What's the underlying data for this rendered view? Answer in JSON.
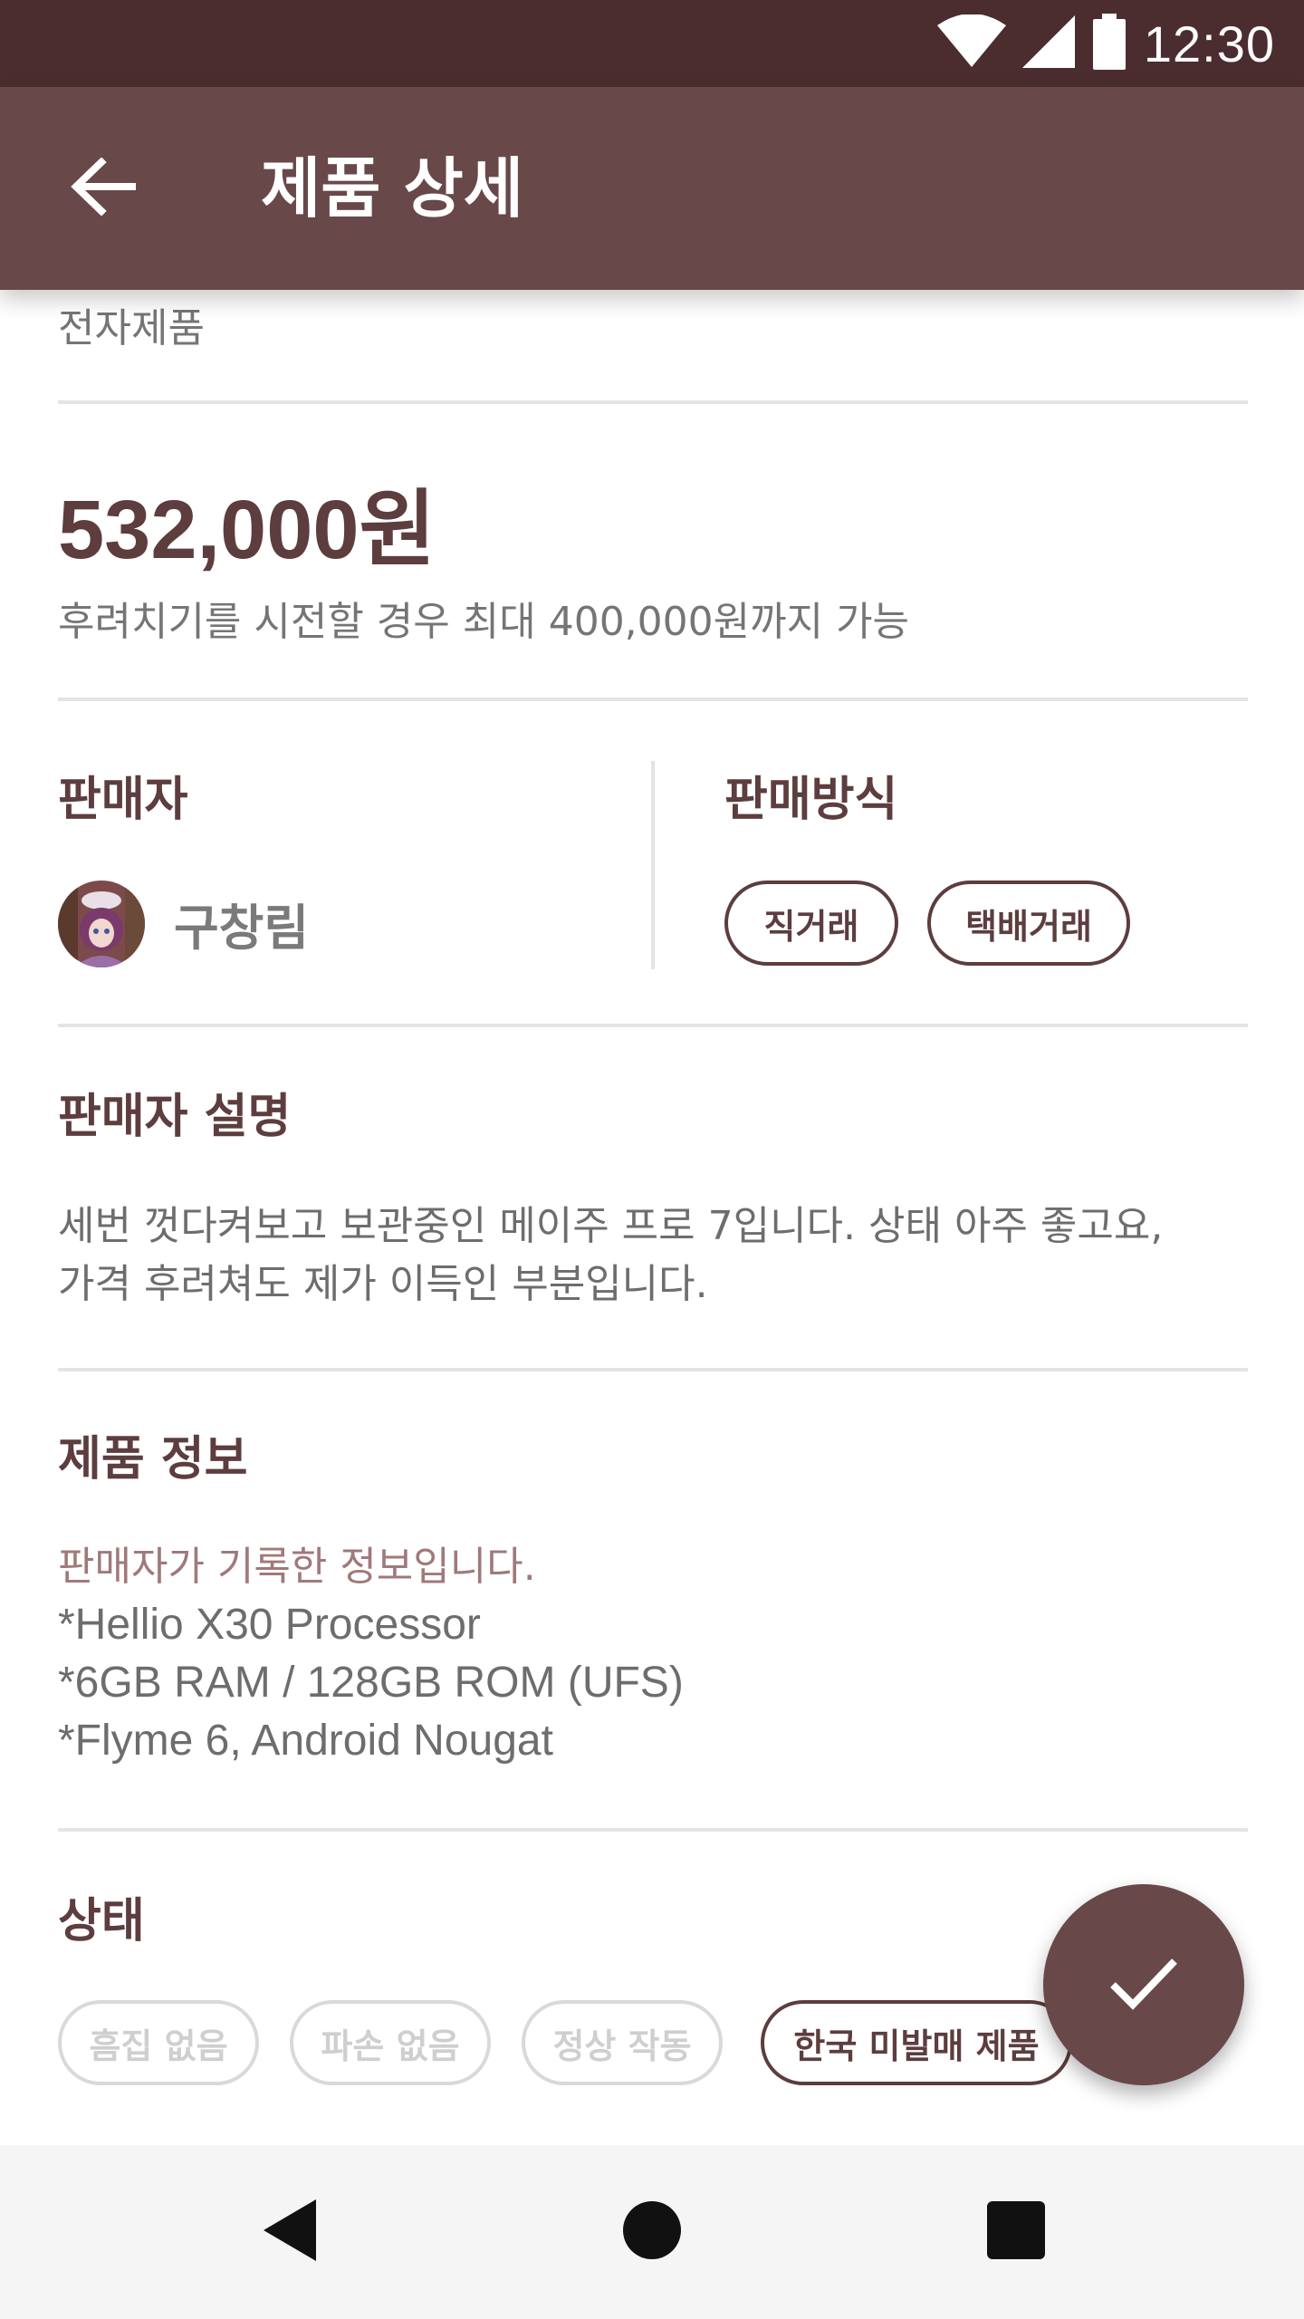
{
  "status_bar": {
    "time": "12:30",
    "icons": [
      "wifi-icon",
      "cell-signal-icon",
      "battery-icon"
    ]
  },
  "app_bar": {
    "title": "제품 상세",
    "back_icon": "arrow-back-icon"
  },
  "product": {
    "category": "전자제품",
    "price": "532,000원",
    "negotiation_note": "후려치기를 시전할 경우 최대 400,000원까지 가능"
  },
  "seller": {
    "section_title": "판매자",
    "name": "구창림",
    "avatar_icon": "seller-avatar"
  },
  "trade_method": {
    "section_title": "판매방식",
    "options": [
      "직거래",
      "택배거래"
    ]
  },
  "seller_description": {
    "section_title": "판매자 설명",
    "lines": [
      "세번 껏다켜보고 보관중인 메이주 프로 7입니다. 상태 아주 좋고요,",
      "가격 후려쳐도 제가 이득인 부분입니다."
    ]
  },
  "product_info": {
    "section_title": "제품 정보",
    "note": "판매자가 기록한 정보입니다.",
    "lines": [
      "*Hellio X30 Processor",
      "*6GB RAM / 128GB ROM (UFS)",
      "*Flyme 6, Android Nougat"
    ]
  },
  "condition": {
    "section_title": "상태",
    "tags": [
      {
        "label": "흠집 없음",
        "selected": false
      },
      {
        "label": "파손 없음",
        "selected": false
      },
      {
        "label": "정상 작동",
        "selected": false
      },
      {
        "label": "한국 미발매 제품",
        "selected": true
      }
    ]
  },
  "fab": {
    "icon": "check-icon"
  },
  "nav_bar": {
    "icons": [
      "nav-back-icon",
      "nav-home-icon",
      "nav-recents-icon"
    ]
  },
  "colors": {
    "status_bar": "#4b2d2f",
    "app_bar": "#694849",
    "accent": "#5d3d3e",
    "note": "#a0797a"
  }
}
